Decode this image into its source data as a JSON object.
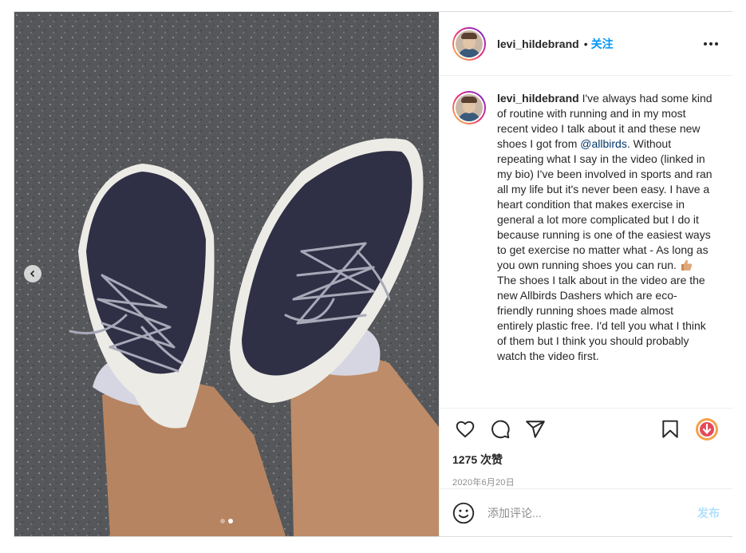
{
  "post": {
    "username": "levi_hildebrand",
    "separator": "•",
    "follow_label": "关注",
    "caption": {
      "username": "levi_hildebrand",
      "text_before": " I've always had some kind of routine with running and in my most recent video I talk about it and these new shoes I got from ",
      "mention": "@allbirds",
      "text_after": ". Without repeating what I say in the video (linked in my bio) I've been involved in sports and ran all my life but it's never been easy. I have a heart condition that makes exercise in general a lot more complicated but I do it because running is one of the easiest ways to get exercise no matter what - As long as you own running shoes you can run. ",
      "paragraph2": "The shoes I talk about in the video are the new Allbirds Dashers which are eco-friendly running shoes made almost entirely plastic free. I'd tell you what I think of them but I think you should probably watch the video first."
    },
    "likes": "1275 次赞",
    "date": "2020年6月20日",
    "comment": {
      "placeholder": "添加评论...",
      "post_label": "发布"
    },
    "icons": {
      "like": "heart-icon",
      "comment": "comment-bubble-icon",
      "share": "paper-plane-icon",
      "save": "bookmark-icon",
      "download": "download-icon",
      "emoji": "smiley-icon",
      "more": "more-options-icon",
      "thumb": "thumbs-up-emoji"
    },
    "carousel": {
      "total": 2,
      "active": 1
    },
    "colors": {
      "link": "#0095f6",
      "mention": "#00376b",
      "post_button_disabled": "#b2dffc",
      "muted": "#8e8e8e"
    }
  }
}
